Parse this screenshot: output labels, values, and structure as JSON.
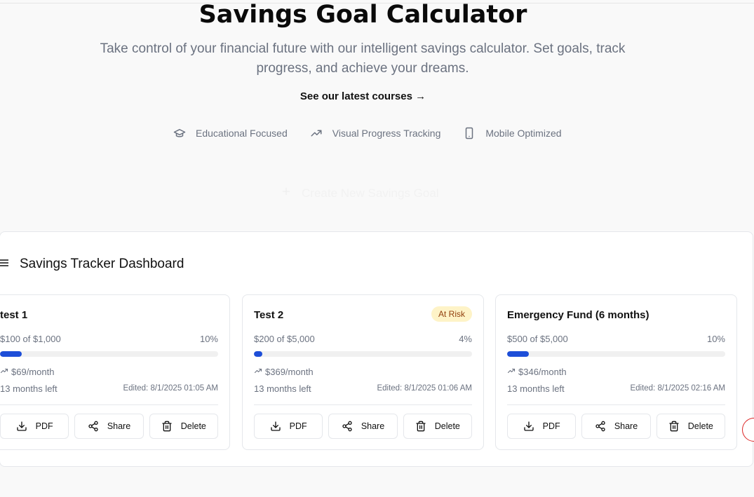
{
  "hero": {
    "title": "Savings Goal Calculator",
    "subtitle": "Take control of your financial future with our intelligent savings calculator. Set goals, track progress, and achieve your dreams.",
    "courses_link": "See our latest courses →",
    "features": [
      {
        "icon": "graduation-cap-icon",
        "label": "Educational Focused"
      },
      {
        "icon": "trending-up-icon",
        "label": "Visual Progress Tracking"
      },
      {
        "icon": "smartphone-icon",
        "label": "Mobile Optimized"
      }
    ],
    "create_button": "Create New Savings Goal"
  },
  "dashboard": {
    "title": "Savings Tracker Dashboard",
    "goals": [
      {
        "name": "test 1",
        "badge": "",
        "amount": "$100 of $1,000",
        "percent_label": "10%",
        "progress": 0.1,
        "monthly": "$69/month",
        "months_left": "13 months left",
        "edited": "Edited: 8/1/2025 01:05 AM"
      },
      {
        "name": "Test 2",
        "badge": "At Risk",
        "amount": "$200 of $5,000",
        "percent_label": "4%",
        "progress": 0.04,
        "monthly": "$369/month",
        "months_left": "13 months left",
        "edited": "Edited: 8/1/2025 01:06 AM"
      },
      {
        "name": "Emergency Fund (6 months)",
        "badge": "",
        "amount": "$500 of $5,000",
        "percent_label": "10%",
        "progress": 0.1,
        "monthly": "$346/month",
        "months_left": "13 months left",
        "edited": "Edited: 8/1/2025 02:16 AM"
      }
    ],
    "actions": {
      "pdf": "PDF",
      "share": "Share",
      "delete": "Delete"
    }
  },
  "colors": {
    "accent": "#1d4ed8",
    "badge_bg": "#fef3c7",
    "badge_text": "#92400e",
    "muted": "#6b7280"
  }
}
